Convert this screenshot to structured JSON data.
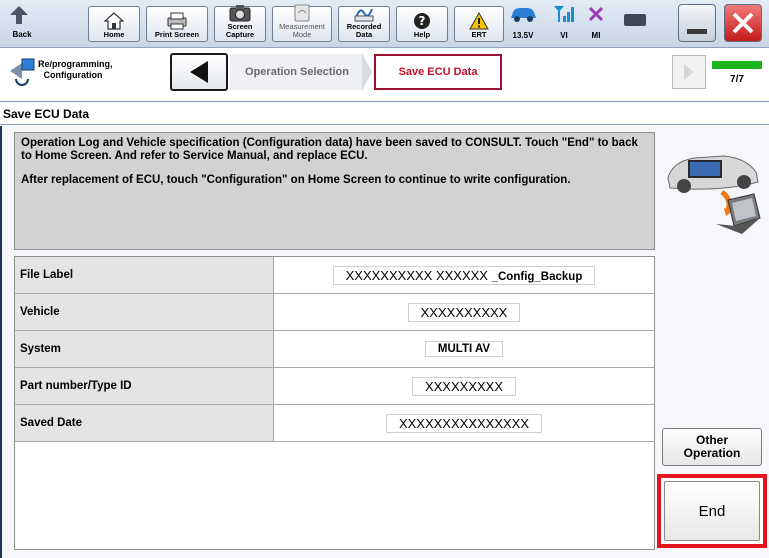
{
  "toolbar": {
    "back_label": "Back",
    "home_label": "Home",
    "print_screen_label": "Print Screen",
    "screen_capture_label": "Screen Capture",
    "measurement_mode_label": "Measurement Mode",
    "recorded_data_label": "Recorded Data",
    "help_label": "Help",
    "ert_label": "ERT",
    "voltage": "13.5V",
    "vi_label": "VI",
    "mi_label": "MI"
  },
  "nav": {
    "breadcrumb_label": "Re/programming, Configuration",
    "steps": [
      {
        "label": "Operation Selection",
        "active": false
      },
      {
        "label": "Save ECU Data",
        "active": true
      }
    ],
    "progress": "7/7",
    "progress_fraction": 1.0
  },
  "page": {
    "title": "Save ECU Data",
    "message_lines": [
      "Operation Log and Vehicle specification (Configuration data) have been saved to CONSULT. Touch \"End\" to back to Home Screen. And refer to Service Manual, and replace ECU.",
      "After replacement of ECU, touch \"Configuration\" on Home Screen to continue to write configuration."
    ]
  },
  "info": {
    "file_label_key": "File Label",
    "file_label_value": "XXXXXXXXXX XXXXXX",
    "file_label_suffix": "_Config_Backup",
    "vehicle_key": "Vehicle",
    "vehicle_value": "XXXXXXXXXX",
    "system_key": "System",
    "system_value": "MULTI AV",
    "part_number_key": "Part number/Type ID",
    "part_number_value": "XXXXXXXXX",
    "saved_date_key": "Saved Date",
    "saved_date_value": "XXXXXXXXXXXXXXX"
  },
  "actions": {
    "other_operation_label": "Other Operation",
    "end_label": "End"
  },
  "colors": {
    "highlight_red": "#e2141e",
    "active_step_text": "#c0102a",
    "progress_green": "#19b51c"
  }
}
